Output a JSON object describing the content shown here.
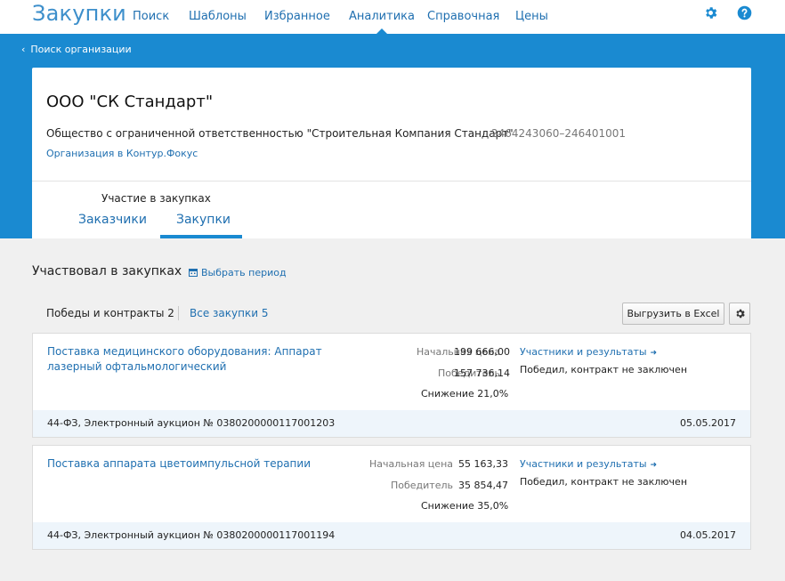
{
  "header": {
    "logo": "Закупки",
    "nav": [
      {
        "label": "Поиск"
      },
      {
        "label": "Шаблоны"
      },
      {
        "label": "Избранное"
      },
      {
        "label": "Аналитика",
        "active": true
      },
      {
        "label": "Справочная"
      },
      {
        "label": "Цены"
      }
    ],
    "settings_icon": "gear-icon",
    "help_icon": "help-icon",
    "accent_color": "#1a8ad1"
  },
  "breadcrumb": {
    "back_label": "Поиск организации"
  },
  "organization": {
    "short_name": "ООО \"СК Стандарт\"",
    "full_name": "Общество с ограниченной ответственностью \"Строительная Компания Стандарт\"",
    "inn_kpp": "2464243060–246401001",
    "focus_link": "Организация в Контур.Фокус",
    "participation_label": "Участие в закупках",
    "tabs": [
      {
        "label": "Заказчики",
        "active": false
      },
      {
        "label": "Закупки",
        "active": true
      }
    ]
  },
  "purchases": {
    "section_title": "Участвовал в закупках",
    "period_link": "Выбрать период",
    "filter_wins": "Победы и контракты 2",
    "filter_all": "Все закупки 5",
    "export_button": "Выгрузить в Excel",
    "items": [
      {
        "title": "Поставка медицинского оборудования: Аппарат лазерный офтальмологический",
        "start_price_label": "Начальная цена",
        "start_price": "199 666,00",
        "winner_label": "Победитель",
        "winner_price": "157 736,14",
        "reduction": "Снижение 21,0%",
        "results_link": "Участники и результаты",
        "status": "Победил, контракт не заключен",
        "procedure": "44-ФЗ, Электронный аукцион № 0380200000117001203",
        "date": "05.05.2017"
      },
      {
        "title": "Поставка аппарата цветоимпульсной терапии",
        "start_price_label": "Начальная цена",
        "start_price": "55 163,33",
        "winner_label": "Победитель",
        "winner_price": "35 854,47",
        "reduction": "Снижение 35,0%",
        "results_link": "Участники и результаты",
        "status": "Победил, контракт не заключен",
        "procedure": "44-ФЗ, Электронный аукцион № 0380200000117001194",
        "date": "04.05.2017"
      }
    ]
  }
}
